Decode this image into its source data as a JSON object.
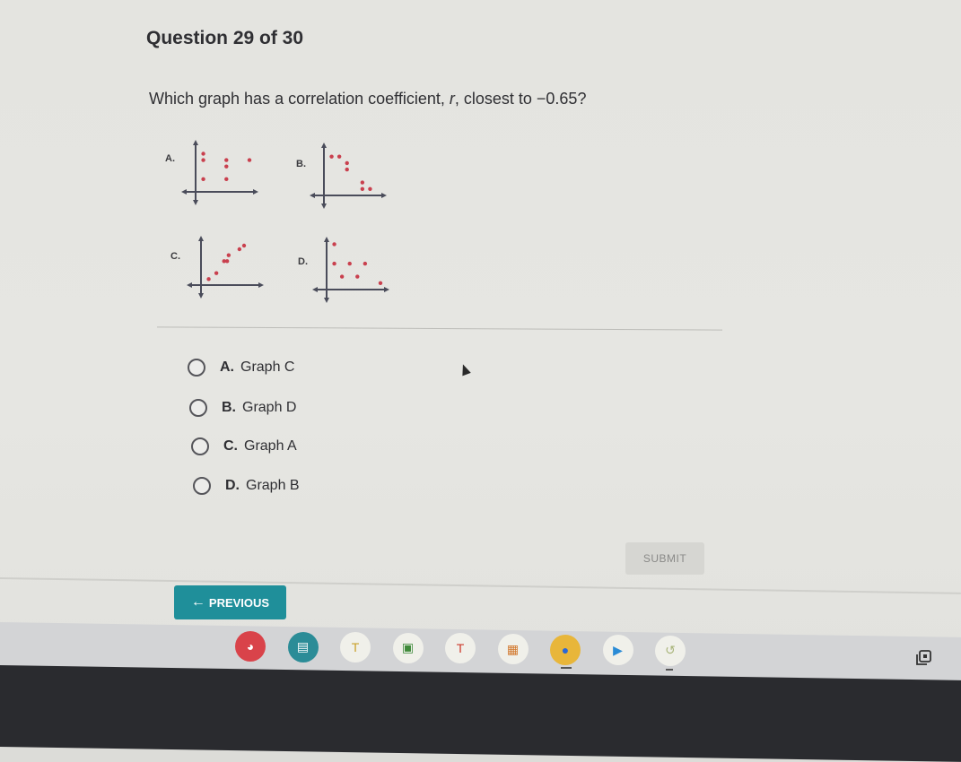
{
  "question": {
    "header": "Question 29 of 30",
    "text_before": "Which graph has a correlation coefficient, ",
    "variable": "r",
    "text_after": ", closest to −0.65?"
  },
  "graphs": [
    {
      "label": "A.",
      "points": [
        [
          1,
          6
        ],
        [
          1,
          5
        ],
        [
          4,
          5
        ],
        [
          4,
          4
        ],
        [
          4,
          2
        ],
        [
          1,
          2
        ],
        [
          7,
          5
        ]
      ]
    },
    {
      "label": "B.",
      "points": [
        [
          1,
          6
        ],
        [
          2,
          6
        ],
        [
          3,
          5
        ],
        [
          3,
          4
        ],
        [
          5,
          2
        ],
        [
          5,
          1
        ],
        [
          6,
          1
        ]
      ]
    },
    {
      "label": "C.",
      "points": [
        [
          1,
          1
        ],
        [
          2,
          2
        ],
        [
          3,
          4
        ],
        [
          3.4,
          4
        ],
        [
          3.6,
          5
        ],
        [
          5,
          6
        ],
        [
          5.6,
          6.6
        ]
      ]
    },
    {
      "label": "D.",
      "points": [
        [
          1,
          7
        ],
        [
          1,
          4
        ],
        [
          3,
          4
        ],
        [
          5,
          4
        ],
        [
          2,
          2
        ],
        [
          4,
          2
        ],
        [
          7,
          1
        ]
      ]
    }
  ],
  "choices": [
    {
      "letter": "A.",
      "text": "Graph C"
    },
    {
      "letter": "B.",
      "text": "Graph D"
    },
    {
      "letter": "C.",
      "text": "Graph A"
    },
    {
      "letter": "D.",
      "text": "Graph B"
    }
  ],
  "buttons": {
    "submit": "SUBMIT",
    "previous": "PREVIOUS",
    "previous_icon": "←"
  },
  "colors": {
    "point": "#c9404e",
    "axis": "#4a4c5a",
    "previous_bg": "#1f8f9a"
  },
  "shelf_apps": [
    {
      "name": "canvas-app-icon",
      "glyph": "◕",
      "bg": "#d9434a",
      "fg": "#fff"
    },
    {
      "name": "card-app-icon",
      "glyph": "▤",
      "bg": "#2b8c97",
      "fg": "#fff"
    },
    {
      "name": "yellow-app-icon",
      "glyph": "T",
      "bg": "#f0f0ea",
      "fg": "#c9a02a"
    },
    {
      "name": "classroom-icon",
      "glyph": "▣",
      "bg": "#f0f0ea",
      "fg": "#3f8a3a"
    },
    {
      "name": "red-app-icon",
      "glyph": "T",
      "bg": "#f0f0ea",
      "fg": "#cc3a2c"
    },
    {
      "name": "grid-app-icon",
      "glyph": "▦",
      "bg": "#f0f0ea",
      "fg": "#d2782d"
    },
    {
      "name": "chrome-icon",
      "glyph": "●",
      "bg": "#e8b63a",
      "fg": "#2a68d6"
    },
    {
      "name": "play-store-icon",
      "glyph": "▶",
      "bg": "#f0f0ea",
      "fg": "#2a8bd6"
    },
    {
      "name": "assistant-app-icon",
      "glyph": "↺",
      "bg": "#f0f0ea",
      "fg": "#a9b47a"
    }
  ]
}
